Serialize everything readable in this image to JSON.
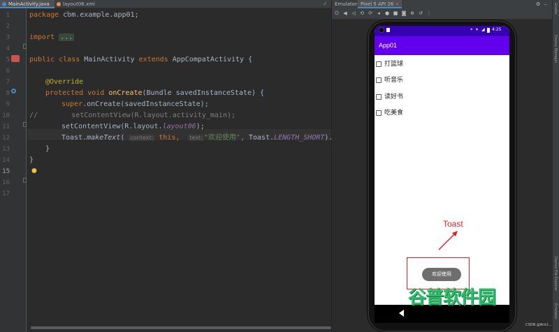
{
  "tabs": [
    {
      "label": "MainActivity.java",
      "active": true,
      "icon_color": "#4a88c7"
    },
    {
      "label": "layout06.xml",
      "active": false,
      "icon_color": "#e0904a"
    }
  ],
  "editor": {
    "line_numbers": [
      "1",
      "2",
      "3",
      "4",
      "5",
      "6",
      "7",
      "8",
      "9",
      "10",
      "11",
      "12",
      "13",
      "14",
      "15",
      "16",
      "17"
    ],
    "current_line": "15",
    "code": {
      "l1_kw": "package",
      "l1_rest": " com.example.app01;",
      "l3_kw": "import",
      "l3_dots": "...",
      "l8_kw1": "public class",
      "l8_name": " MainActivity ",
      "l8_kw2": "extends",
      "l8_rest": " AppCompatActivity {",
      "l10_ann": "@Override",
      "l11_kw": "protected void",
      "l11_fn": " onCreate",
      "l11_rest": "(Bundle savedInstanceState) {",
      "l12_kw": "super",
      "l12_rest": ".onCreate(savedInstanceState);",
      "l13_comment": "//        setContentView(R.layout.activity_main);",
      "l14_pre": "setContentView(R.layout.",
      "l14_it": "layout06",
      "l14_post": ");",
      "l15_cls": "Toast",
      "l15_dot": ".",
      "l15_method": "makeText",
      "l15_paren": "(",
      "l15_hint_context": "context:",
      "l15_this": " this",
      "l15_comma": ",  ",
      "l15_hint_text": "text:",
      "l15_str": "\"欢迎使用\"",
      "l15_comma2": ", ",
      "l15_toast2": "Toast",
      "l15_dot2": ".",
      "l15_const": "LENGTH_SHORT",
      "l15_end": ").show();",
      "l16": "}",
      "l17": "}"
    }
  },
  "emulator": {
    "label": "Emulator:",
    "device_tab": "Pixel 5 API 26",
    "toolbar_icons": [
      "power-icon",
      "volume-up-icon",
      "volume-down-icon",
      "rotate-left-icon",
      "rotate-right-icon",
      "back-icon",
      "home-icon",
      "overview-icon",
      "camera-icon",
      "zoom-icon",
      "snapshot-icon",
      "more-icon"
    ],
    "right_icons": [
      "settings-icon",
      "minimize-icon"
    ]
  },
  "side_panels": [
    "Gradle",
    "Device Manager",
    "Device File Explorer",
    "Emulator"
  ],
  "phone": {
    "status_time": "4:25",
    "app_title": "App01",
    "checkboxes": [
      "打篮球",
      "听音乐",
      "读好书",
      "吃美食"
    ],
    "toast_text": "欢迎使用",
    "toast_annotation": "Toast"
  },
  "watermark": "谷普软件园",
  "credit": "CSDN @Arict..."
}
